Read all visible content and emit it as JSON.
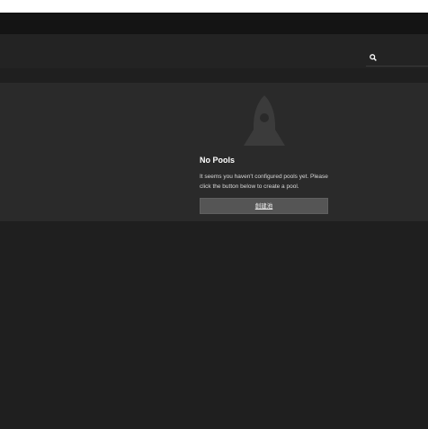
{
  "empty_state": {
    "title": "No Pools",
    "description": "It seems you haven't configured pools yet. Please click the button below to create a pool.",
    "button_label": "創建池"
  },
  "icons": {
    "search": "search-icon",
    "illustration": "rocket-icon"
  },
  "colors": {
    "background": "#1f1f1f",
    "panel": "#2a2a2a",
    "header": "#232323",
    "top_bar": "#141414",
    "button": "#555555",
    "rocket": "#3b3b3b"
  }
}
